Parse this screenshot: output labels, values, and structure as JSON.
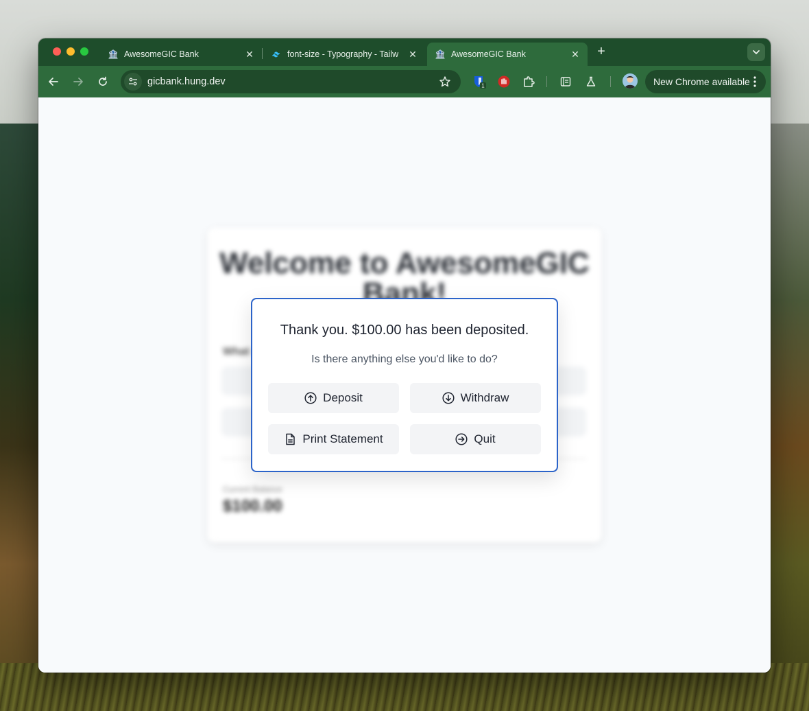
{
  "browser": {
    "tabs": [
      {
        "title": "AwesomeGIC Bank",
        "favicon": "bank-icon",
        "active": false
      },
      {
        "title": "font-size - Typography - Tailw",
        "favicon": "tailwind-icon",
        "active": false
      },
      {
        "title": "AwesomeGIC Bank",
        "favicon": "bank-icon",
        "active": true
      }
    ],
    "url": "gicbank.hung.dev",
    "update_label": "New Chrome available",
    "extension_badge": "1",
    "colors": {
      "tabbar": "#1e4d2b",
      "toolbar": "#2e6b3c"
    }
  },
  "page": {
    "welcome": "Welcome to AwesomeGIC Bank!",
    "balance_label": "Current Balance",
    "balance_value": "$100.00"
  },
  "dialog": {
    "message": "Thank you. $100.00 has been deposited.",
    "prompt": "Is there anything else you'd like to do?",
    "buttons": {
      "deposit": "Deposit",
      "withdraw": "Withdraw",
      "print": "Print Statement",
      "quit": "Quit"
    },
    "border_color": "#2b63c9"
  }
}
